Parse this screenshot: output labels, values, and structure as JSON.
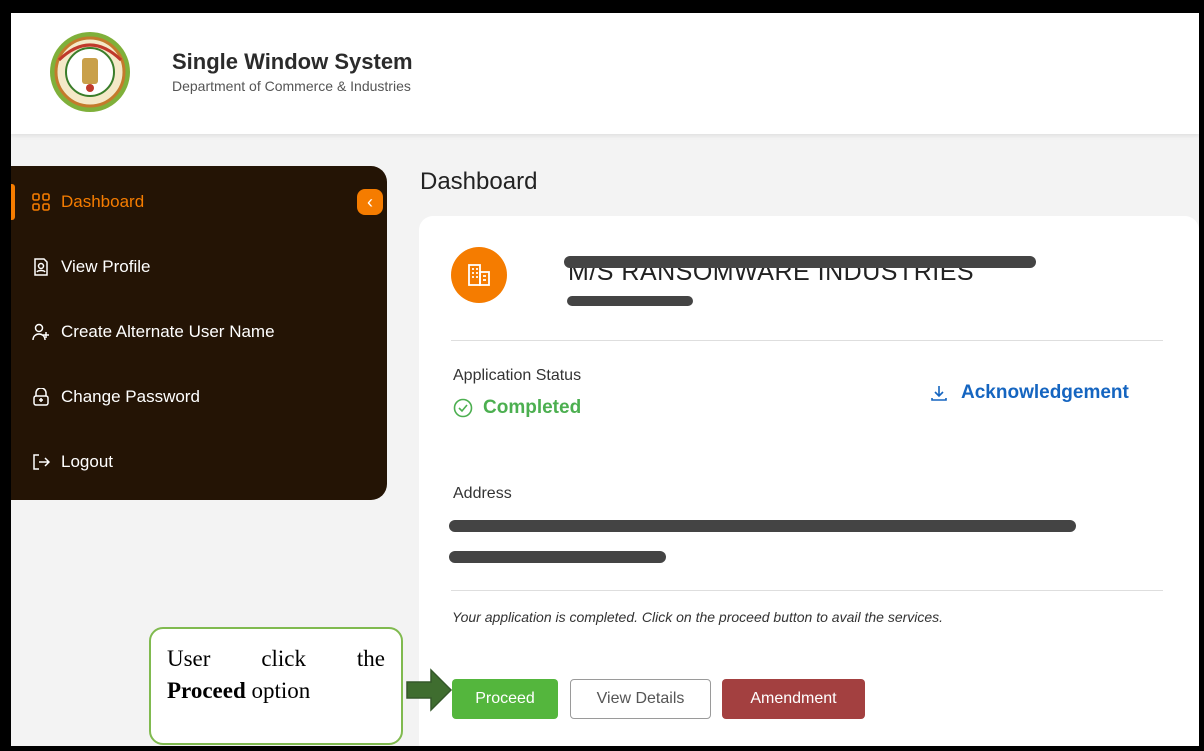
{
  "header": {
    "title": "Single Window System",
    "subtitle": "Department of Commerce & Industries",
    "logo_icon": "state-emblem-seal"
  },
  "sidebar": {
    "items": [
      {
        "label": "Dashboard",
        "icon": "grid-icon",
        "active": true
      },
      {
        "label": "View Profile",
        "icon": "profile-doc-icon"
      },
      {
        "label": "Create Alternate User Name",
        "icon": "user-plus-icon"
      },
      {
        "label": "Change Password",
        "icon": "lock-icon"
      },
      {
        "label": "Logout",
        "icon": "logout-icon"
      }
    ],
    "collapse_icon": "chevron-left-icon"
  },
  "main": {
    "title": "Dashboard",
    "card": {
      "company_name": "M/S RANSOMWARE INDUSTRIES",
      "application_status_label": "Application Status",
      "status": "Completed",
      "acknowledgement_label": "Acknowledgement",
      "address_label": "Address",
      "note": "Your application is completed. Click on the proceed button to avail the services.",
      "buttons": {
        "proceed": "Proceed",
        "view_details": "View Details",
        "amendment": "Amendment"
      }
    }
  },
  "callout": {
    "line1_words": [
      "User",
      "click",
      "the"
    ],
    "bold": "Proceed",
    "rest": " option"
  },
  "colors": {
    "accent": "#f57c00",
    "sidebar_bg": "#241405",
    "success": "#4caf50",
    "link": "#1565c0",
    "amendment": "#a34040"
  }
}
